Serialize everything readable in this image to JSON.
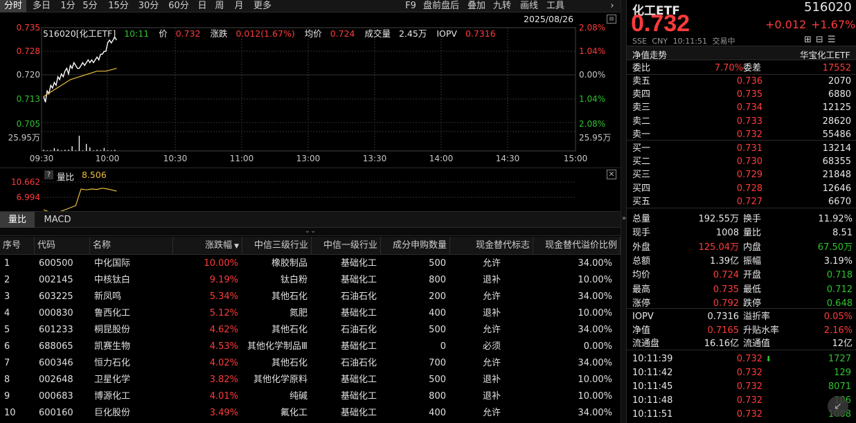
{
  "toolbar": {
    "items": [
      "分时",
      "多日",
      "1分",
      "5分",
      "15分",
      "30分",
      "60分",
      "日",
      "周",
      "月",
      "更多"
    ],
    "right_items": [
      "F9",
      "盘前盘后",
      "叠加",
      "九转",
      "画线",
      "工具"
    ],
    "chevron": "›"
  },
  "chart_info": {
    "code_name": "516020[化工ETF]",
    "time": "10:11",
    "price_label": "价",
    "price": "0.732",
    "change_label": "涨跌",
    "change": "0.012(1.67%)",
    "avg_label": "均价",
    "avg": "0.724",
    "volume_label": "成交量",
    "volume": "2.45万",
    "iopv_label": "IOPV",
    "iopv": "0.7316",
    "date": "2025/08/26"
  },
  "chart_data": [
    {
      "type": "line",
      "title": "",
      "x_ticks": [
        "09:30",
        "10:00",
        "10:30",
        "11:00",
        "13:00",
        "13:30",
        "14:00",
        "14:30",
        "15:00"
      ],
      "y_ticks_left": [
        "0.735",
        "0.728",
        "0.720",
        "0.713",
        "0.705"
      ],
      "y_ticks_right": [
        "2.08%",
        "1.04%",
        "0.00%",
        "1.04%",
        "2.08%"
      ],
      "ylim": [
        0.7016,
        0.7384
      ],
      "volume_max_label": "25.95万",
      "series": [
        {
          "name": "",
          "color": "#ffffff",
          "x": [
            0,
            1,
            2,
            3,
            4,
            5,
            6,
            7,
            8,
            9,
            10,
            11,
            12,
            13,
            14,
            15,
            16,
            17,
            18,
            19,
            20,
            21,
            22,
            23,
            24,
            25,
            26,
            27,
            28,
            29,
            30,
            31,
            32,
            33,
            34,
            35,
            36,
            37,
            38,
            39,
            40,
            41
          ],
          "values": [
            0.714,
            0.712,
            0.716,
            0.715,
            0.718,
            0.717,
            0.719,
            0.718,
            0.721,
            0.72,
            0.722,
            0.721,
            0.723,
            0.724,
            0.722,
            0.725,
            0.724,
            0.726,
            0.725,
            0.724,
            0.724,
            0.725,
            0.726,
            0.725,
            0.726,
            0.727,
            0.726,
            0.727,
            0.726,
            0.727,
            0.728,
            0.727,
            0.729,
            0.729,
            0.73,
            0.73,
            0.733,
            0.734,
            0.733,
            0.734,
            0.735,
            0.734
          ]
        },
        {
          "name": "",
          "color": "#f0c040",
          "x": [
            0,
            5,
            10,
            15,
            20,
            25,
            30,
            35,
            41
          ],
          "values": [
            0.714,
            0.716,
            0.718,
            0.72,
            0.721,
            0.722,
            0.723,
            0.723,
            0.724
          ]
        }
      ],
      "volume_bars": {
        "x": [
          0,
          2,
          4,
          6,
          8,
          10,
          12,
          14,
          16,
          18,
          20,
          22,
          24,
          26,
          28,
          30,
          32,
          34,
          36,
          38,
          40
        ],
        "values": [
          2,
          1,
          1,
          5,
          3,
          1,
          2,
          2,
          8,
          1,
          25.95,
          1,
          12,
          6,
          1,
          2,
          1,
          5,
          1,
          1,
          2
        ]
      }
    },
    {
      "type": "line",
      "title": "量比",
      "value_label": "8.506",
      "y_ticks": [
        "10.662",
        "6.994"
      ],
      "series": [
        {
          "name": "量比",
          "color": "#f0c040",
          "x": [
            0,
            3,
            6,
            9,
            12,
            15,
            18,
            21,
            24,
            27,
            30,
            33,
            36,
            39,
            41
          ],
          "values": [
            4.0,
            3.5,
            3.3,
            3.5,
            4.0,
            4.5,
            5.0,
            9.0,
            8.8,
            9.0,
            8.9,
            9.2,
            9.0,
            8.7,
            8.5
          ]
        }
      ]
    }
  ],
  "subtabs": [
    "量比",
    "MACD"
  ],
  "table": {
    "headers": [
      "序号",
      "代码",
      "名称",
      "涨跌幅",
      "中信三级行业",
      "中信一级行业",
      "成分申购数量",
      "现金替代标志",
      "现金替代溢价比例"
    ],
    "sort_mark": "▼",
    "rows": [
      [
        "1",
        "600500",
        "中化国际",
        "10.00%",
        "橡胶制品",
        "基础化工",
        "500",
        "允许",
        "34.00%"
      ],
      [
        "2",
        "002145",
        "中核钛白",
        "9.19%",
        "钛白粉",
        "基础化工",
        "800",
        "退补",
        "10.00%"
      ],
      [
        "3",
        "603225",
        "新凤鸣",
        "5.34%",
        "其他石化",
        "石油石化",
        "200",
        "允许",
        "34.00%"
      ],
      [
        "4",
        "000830",
        "鲁西化工",
        "5.12%",
        "氮肥",
        "基础化工",
        "400",
        "退补",
        "10.00%"
      ],
      [
        "5",
        "601233",
        "桐昆股份",
        "4.62%",
        "其他石化",
        "石油石化",
        "500",
        "允许",
        "34.00%"
      ],
      [
        "6",
        "688065",
        "凯赛生物",
        "4.53%",
        "其他化学制品Ⅲ",
        "基础化工",
        "0",
        "必须",
        "0.00%"
      ],
      [
        "7",
        "600346",
        "恒力石化",
        "4.02%",
        "其他石化",
        "石油石化",
        "700",
        "允许",
        "34.00%"
      ],
      [
        "8",
        "002648",
        "卫星化学",
        "3.82%",
        "其他化学原料",
        "基础化工",
        "500",
        "退补",
        "10.00%"
      ],
      [
        "9",
        "000683",
        "博源化工",
        "4.01%",
        "纯碱",
        "基础化工",
        "800",
        "退补",
        "10.00%"
      ],
      [
        "10",
        "600160",
        "巨化股份",
        "3.49%",
        "氟化工",
        "基础化工",
        "400",
        "允许",
        "34.00%"
      ]
    ]
  },
  "quote": {
    "name": "化工ETF",
    "code": "516020",
    "price": "0.732",
    "change": "+0.012",
    "change_pct": "+1.67%",
    "exchange": "SSE",
    "currency": "CNY",
    "time": "10:11:51",
    "status": "交易中",
    "nav_trend": "净值走势",
    "fund_company": "华宝化工ETF"
  },
  "orderbook": {
    "weibi_label": "委比",
    "weibi": "7.70%",
    "weicha_label": "委差",
    "weicha": "17552",
    "asks": [
      [
        "卖五",
        "0.736",
        "2070"
      ],
      [
        "卖四",
        "0.735",
        "6880"
      ],
      [
        "卖三",
        "0.734",
        "12125"
      ],
      [
        "卖二",
        "0.733",
        "28620"
      ],
      [
        "卖一",
        "0.732",
        "55486"
      ]
    ],
    "bids": [
      [
        "买一",
        "0.731",
        "13214"
      ],
      [
        "买二",
        "0.730",
        "68355"
      ],
      [
        "买三",
        "0.729",
        "21848"
      ],
      [
        "买四",
        "0.728",
        "12646"
      ],
      [
        "买五",
        "0.727",
        "6670"
      ]
    ]
  },
  "stats": [
    [
      "总量",
      "192.55万",
      "换手",
      "11.92%"
    ],
    [
      "现手",
      "1008",
      "量比",
      "8.51"
    ],
    [
      "外盘",
      "125.04万",
      "内盘",
      "67.50万"
    ],
    [
      "总额",
      "1.39亿",
      "振幅",
      "3.19%"
    ],
    [
      "均价",
      "0.724",
      "开盘",
      "0.718"
    ],
    [
      "最高",
      "0.735",
      "最低",
      "0.712"
    ],
    [
      "涨停",
      "0.792",
      "跌停",
      "0.648"
    ]
  ],
  "stats2": [
    [
      "IOPV",
      "0.7316",
      "溢折率",
      "0.05%"
    ],
    [
      "净值",
      "0.7165",
      "升贴水率",
      "2.16%"
    ],
    [
      "流通盘",
      "16.16亿",
      "流通值",
      "12亿"
    ]
  ],
  "ticks": [
    [
      "10:11:39",
      "0.732",
      "1727"
    ],
    [
      "10:11:42",
      "0.732",
      "129"
    ],
    [
      "10:11:45",
      "0.732",
      "8071"
    ],
    [
      "10:11:48",
      "0.732",
      "106"
    ],
    [
      "10:11:51",
      "0.732",
      "1008"
    ]
  ],
  "colors": {
    "up": "#ff3b3b",
    "down": "#2fc32f",
    "avg": "#f0c040",
    "price_line": "#ffffff"
  }
}
